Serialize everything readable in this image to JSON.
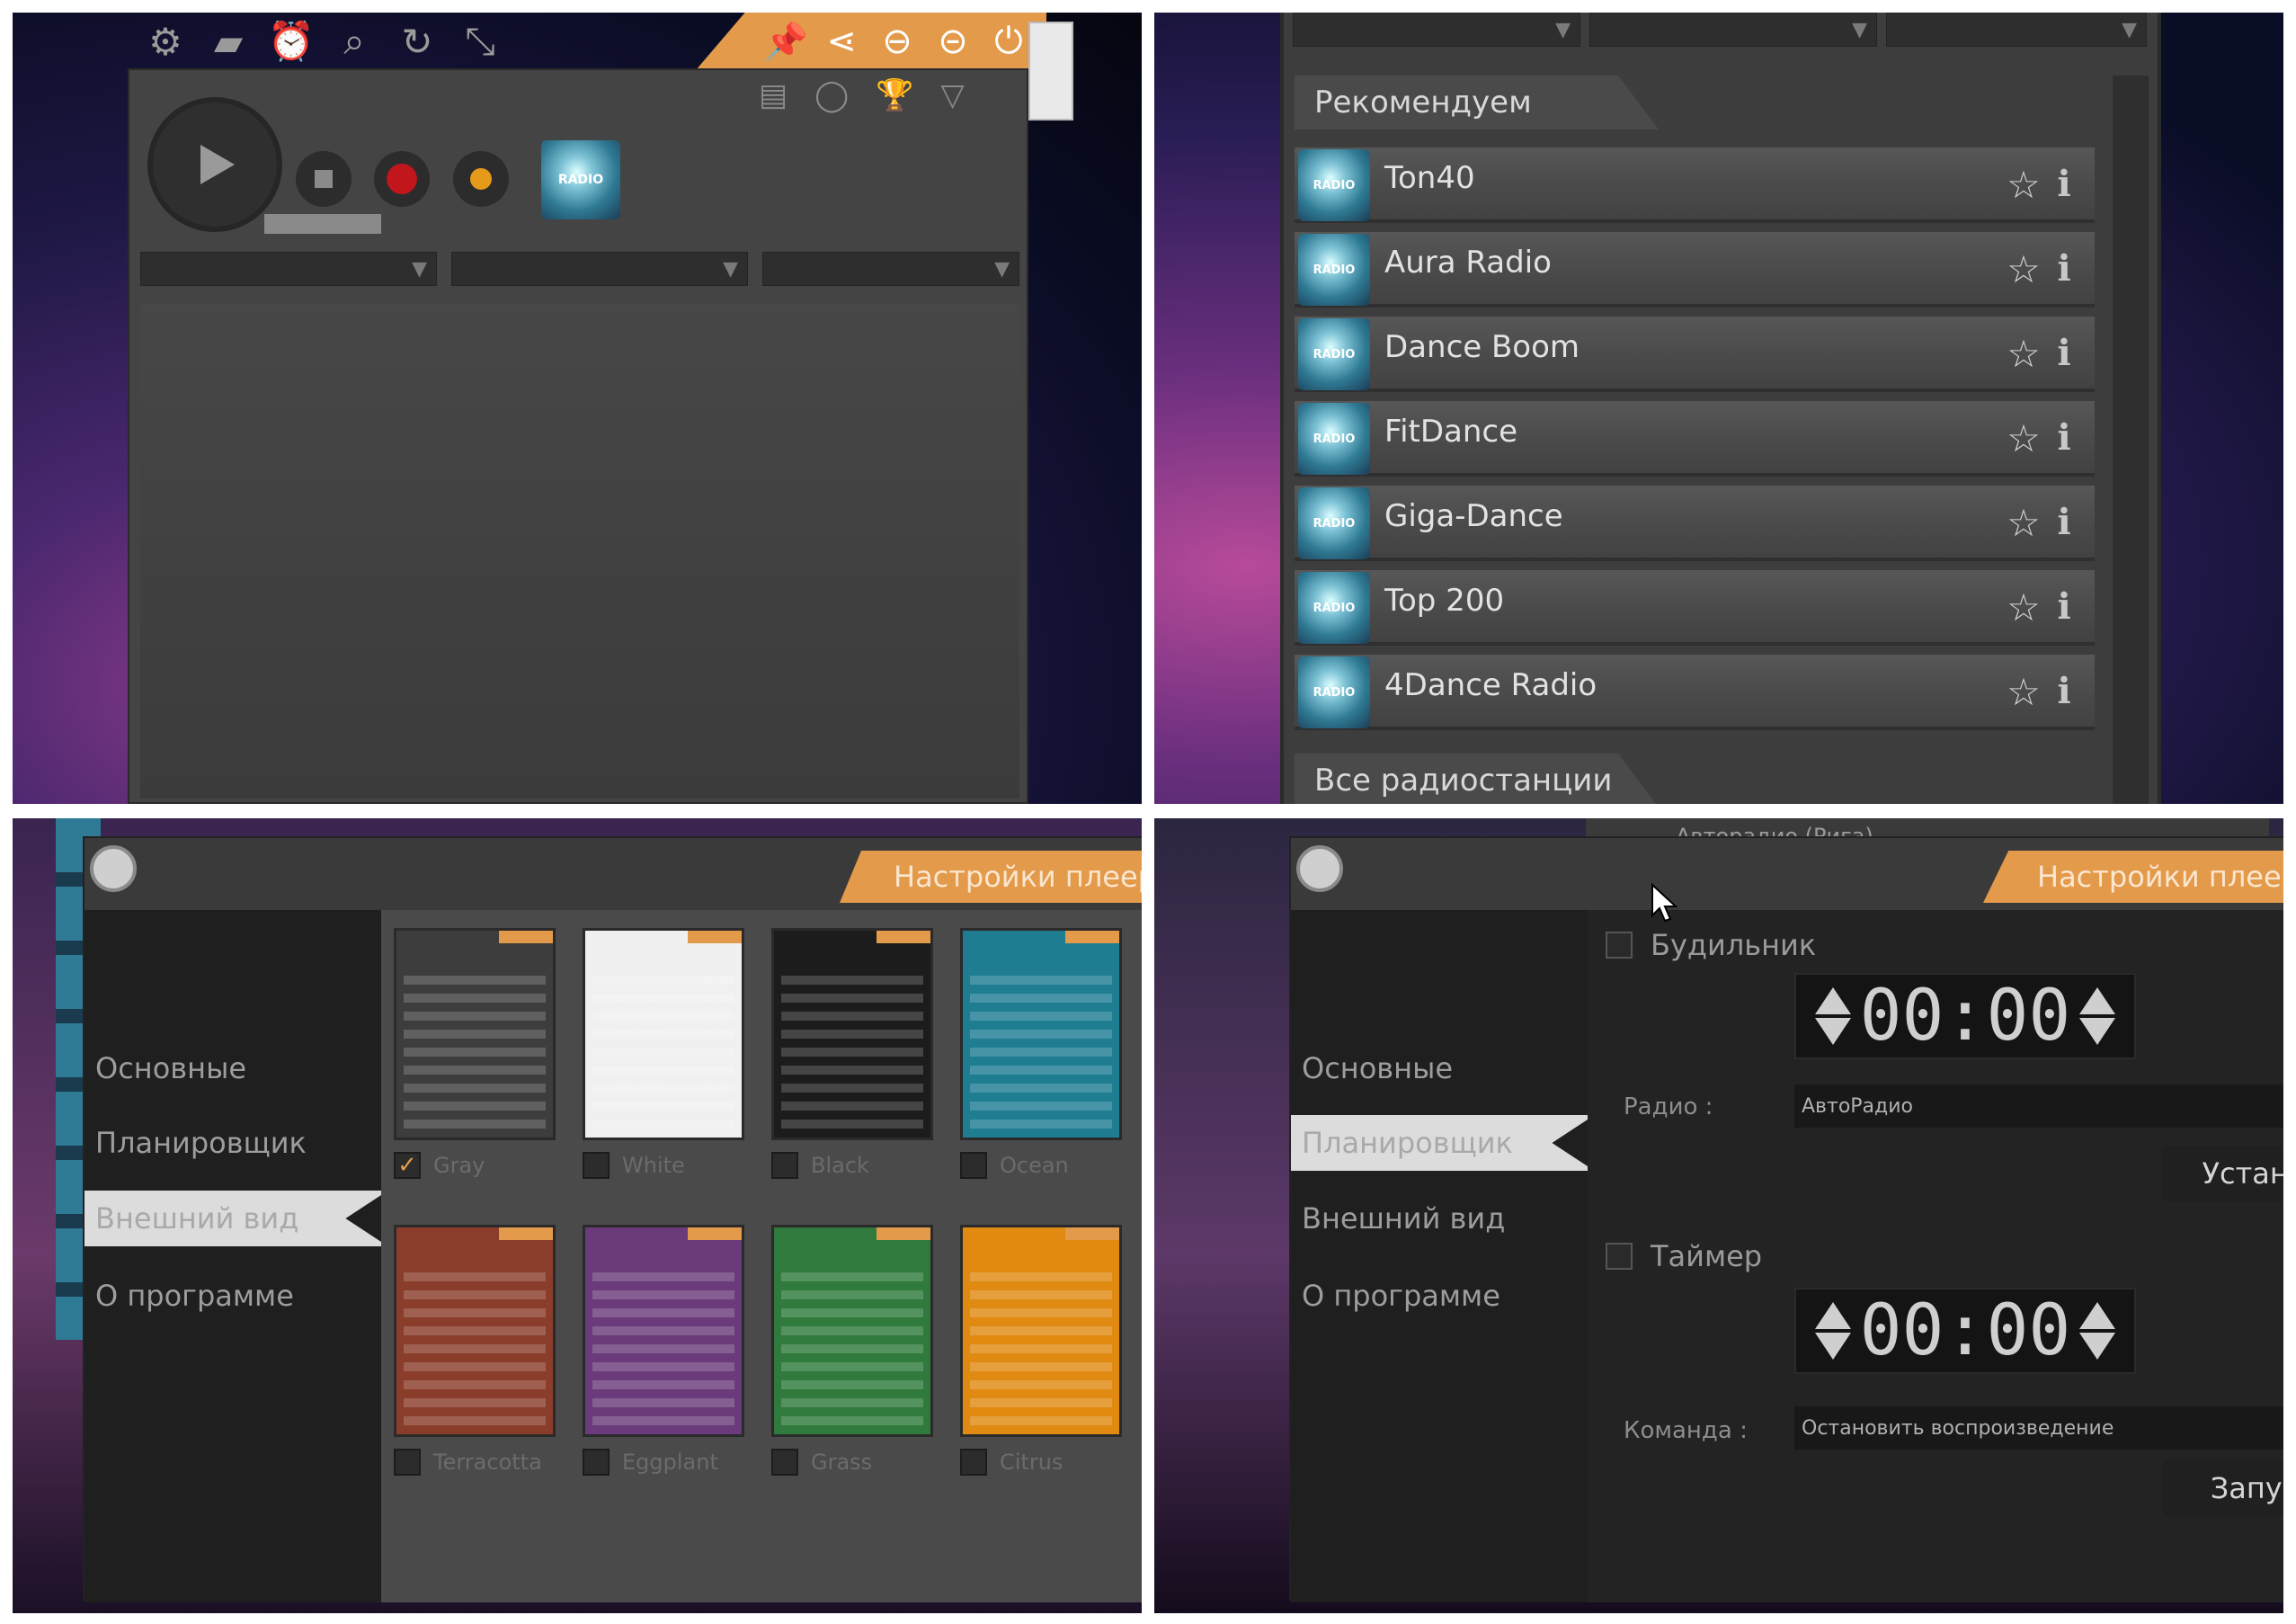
{
  "q1": {
    "toolbar_icons": [
      "gear-icon",
      "folder-icon",
      "alarm-clock-icon",
      "search-icon",
      "refresh-icon",
      "resize-icon"
    ],
    "tab_icons": [
      "pin-icon",
      "share-icon",
      "minimize-icon",
      "restore-icon",
      "power-icon"
    ],
    "logo_text": "RADIO",
    "dropdown_arrow": "▼"
  },
  "q2": {
    "recommended_header": "Рекомендуем",
    "all_header": "Все радиостанции",
    "logo_text": "RADIO",
    "stations": [
      {
        "name": "Ton40"
      },
      {
        "name": "Aura Radio"
      },
      {
        "name": "Dance Boom"
      },
      {
        "name": "FitDance"
      },
      {
        "name": "Giga-Dance"
      },
      {
        "name": "Top 200"
      },
      {
        "name": "4Dance Radio"
      }
    ]
  },
  "q3": {
    "header_tab": "Настройки плеера",
    "sidebar": [
      "Основные",
      "Планировщик",
      "Внешний вид",
      "О программе"
    ],
    "active_index": 2,
    "skins": [
      {
        "name": "Gray",
        "color": "#3d3d3d",
        "checked": true
      },
      {
        "name": "White",
        "color": "#f0f0f0",
        "checked": false
      },
      {
        "name": "Black",
        "color": "#1c1c1c",
        "checked": false
      },
      {
        "name": "Ocean",
        "color": "#1f7d92",
        "checked": false
      },
      {
        "name": "Terracotta",
        "color": "#8a3d2b",
        "checked": false
      },
      {
        "name": "Eggplant",
        "color": "#6a3a7a",
        "checked": false
      },
      {
        "name": "Grass",
        "color": "#2f7a3c",
        "checked": false
      },
      {
        "name": "Citrus",
        "color": "#e08a12",
        "checked": false
      }
    ]
  },
  "q4": {
    "header_tab": "Настройки плеера",
    "top_station": "Авторадио (Рига)",
    "sidebar": [
      "Основные",
      "Планировщик",
      "Внешний вид",
      "О программе"
    ],
    "active_index": 1,
    "alarm_label": "Будильник",
    "alarm_time": "00:00",
    "radio_label": "Радио :",
    "radio_value": "АвтоРадио",
    "set_button": "Установить",
    "timer_label": "Таймер",
    "timer_time": "00:00",
    "command_label": "Команда :",
    "command_value": "Остановить воспроизведение",
    "start_button": "Запустить"
  }
}
